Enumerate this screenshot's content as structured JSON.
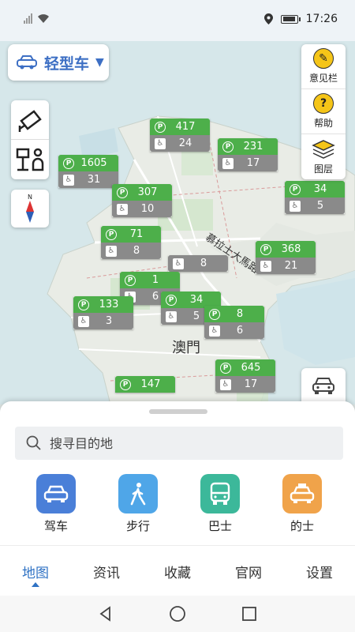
{
  "status_bar": {
    "time": "17:26"
  },
  "vehicle_selector": {
    "label": "轻型车",
    "chevron": "▼"
  },
  "right_tools": [
    {
      "label": "意见栏",
      "icon": "edit-icon"
    },
    {
      "label": "帮助",
      "icon": "help-icon"
    },
    {
      "label": "图层",
      "icon": "layers-icon"
    }
  ],
  "map": {
    "city_label": "澳門",
    "road_label": "慕拉士大馬路",
    "parking": [
      {
        "available": "417",
        "accessible": "24"
      },
      {
        "available": "231",
        "accessible": "17"
      },
      {
        "available": "1605",
        "accessible": "31"
      },
      {
        "available": "307",
        "accessible": "10"
      },
      {
        "available": "34",
        "accessible": "5"
      },
      {
        "available": "71",
        "accessible": "8"
      },
      {
        "available": "",
        "accessible": "8"
      },
      {
        "available": "368",
        "accessible": "21"
      },
      {
        "available": "1",
        "accessible": "6"
      },
      {
        "available": "133",
        "accessible": "3"
      },
      {
        "available": "34",
        "accessible": "5"
      },
      {
        "available": "8",
        "accessible": "6"
      },
      {
        "available": "645",
        "accessible": "17"
      },
      {
        "available": "147",
        "accessible": ""
      }
    ]
  },
  "search": {
    "placeholder": "搜寻目的地"
  },
  "modes": [
    {
      "label": "驾车",
      "color": "#4a7fd8",
      "icon": "car-icon"
    },
    {
      "label": "步行",
      "color": "#4fa6e8",
      "icon": "walk-icon"
    },
    {
      "label": "巴士",
      "color": "#3cb89a",
      "icon": "bus-icon"
    },
    {
      "label": "的士",
      "color": "#f0a34a",
      "icon": "taxi-icon"
    }
  ],
  "tabs": [
    {
      "label": "地图",
      "active": true
    },
    {
      "label": "资讯"
    },
    {
      "label": "收藏"
    },
    {
      "label": "官网"
    },
    {
      "label": "设置"
    }
  ],
  "colors": {
    "accent": "#2f72c4",
    "parking_green": "#4daf4a",
    "parking_gray": "#8a8a8a"
  }
}
